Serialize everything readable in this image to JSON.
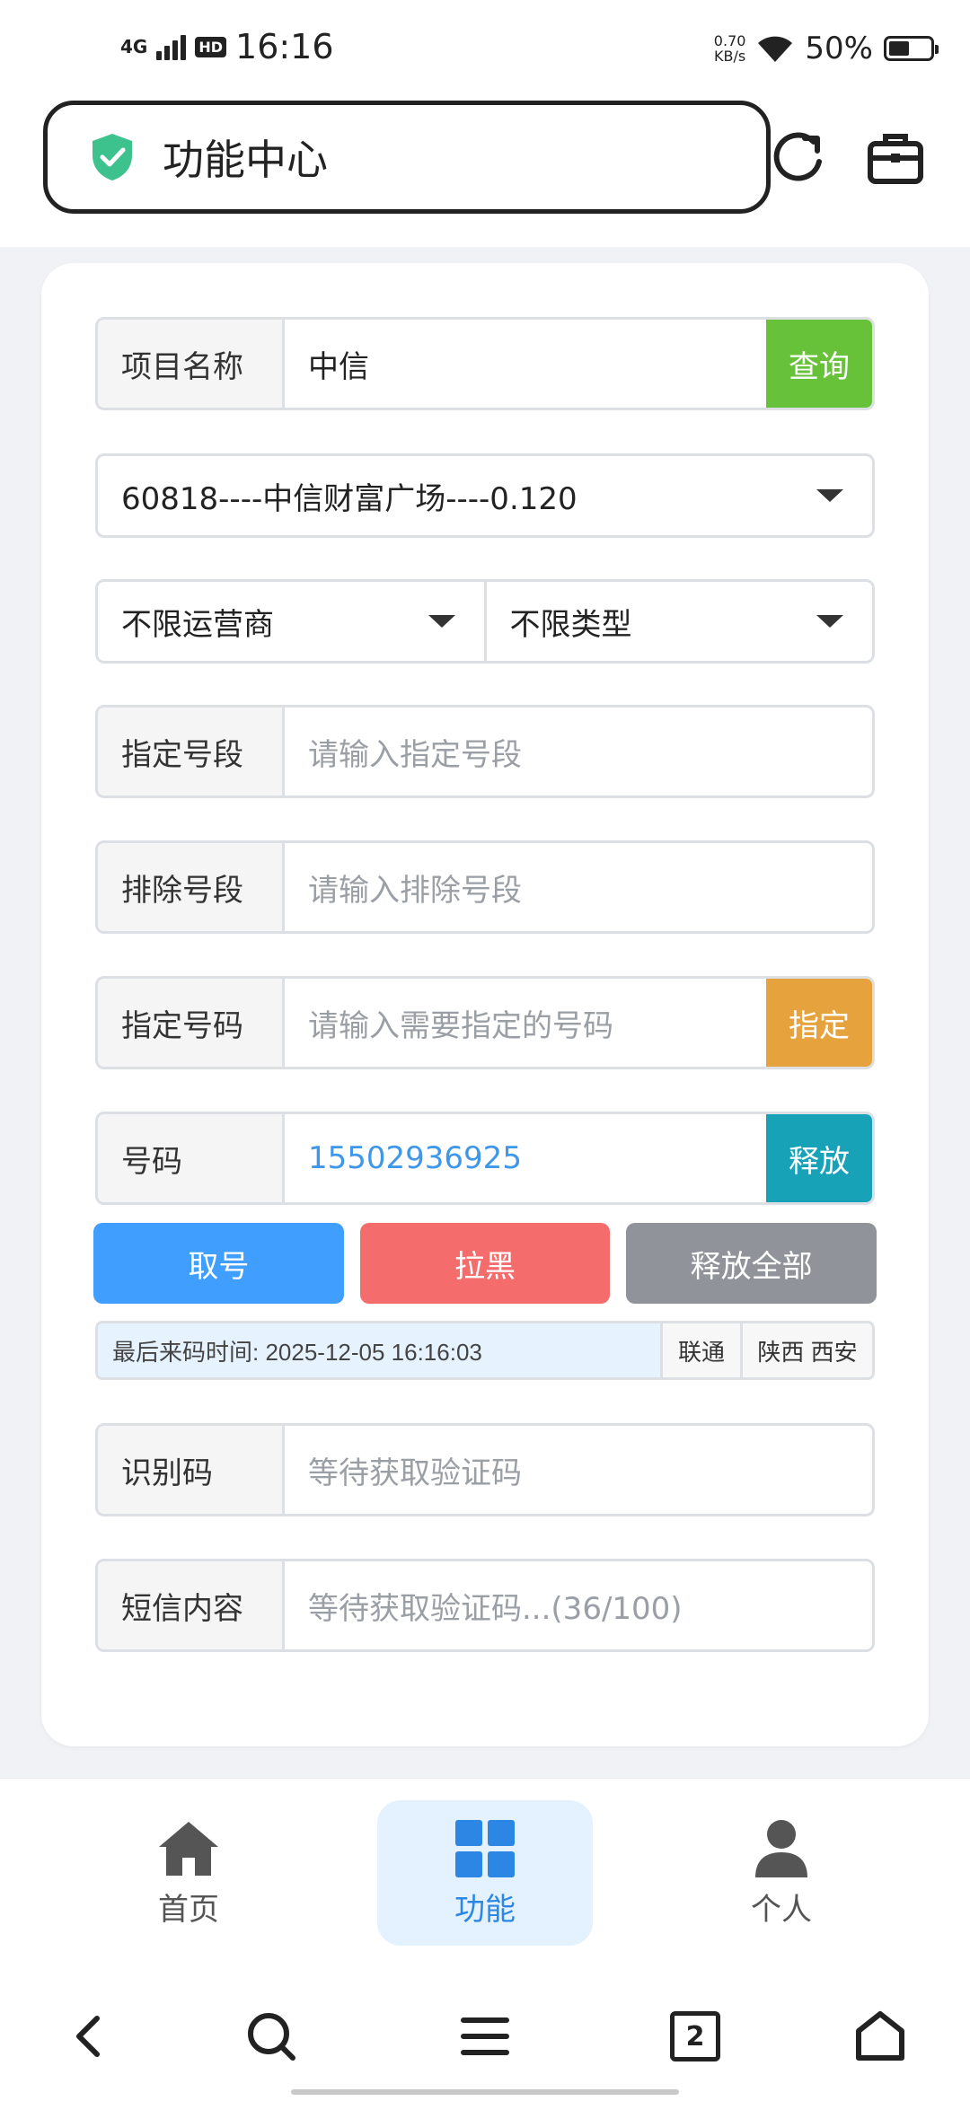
{
  "status_bar": {
    "network": "4G",
    "hd": "HD",
    "time": "16:16",
    "speed_value": "0.70",
    "speed_unit": "KB/s",
    "battery_percent": "50%",
    "battery_level": 0.5
  },
  "header": {
    "title": "功能中心",
    "icons": [
      "shield-check-icon",
      "refresh-icon",
      "briefcase-icon"
    ]
  },
  "form": {
    "project": {
      "label": "项目名称",
      "value": "中信",
      "button": "查询"
    },
    "project_select": "60818----中信财富广场----0.120",
    "operator_select": "不限运营商",
    "type_select": "不限类型",
    "number_prefix": {
      "label": "指定号段",
      "placeholder": "请输入指定号段"
    },
    "exclude_prefix": {
      "label": "排除号段",
      "placeholder": "请输入排除号段"
    },
    "specified_number": {
      "label": "指定号码",
      "placeholder": "请输入需要指定的号码",
      "button": "指定"
    },
    "phone": {
      "label": "号码",
      "value": "15502936925",
      "button": "释放"
    },
    "actions": {
      "get_number": "取号",
      "blacklist": "拉黑",
      "release_all": "释放全部"
    },
    "info": {
      "last_code_time": "最后来码时间: 2025-12-05 16:16:03",
      "carrier": "联通",
      "region": "陕西 西安"
    },
    "verify_code": {
      "label": "识别码",
      "placeholder": "等待获取验证码"
    },
    "sms": {
      "label": "短信内容",
      "placeholder": "等待获取验证码...(36/100)"
    }
  },
  "colors": {
    "query": "#67c23a",
    "specify": "#e6a23c",
    "release": "#17a2b8",
    "get_number": "#409eff",
    "blacklist": "#f56c6c",
    "release_all": "#909399",
    "accent": "#2b87e3"
  },
  "bottom_nav": {
    "items": [
      {
        "label": "首页",
        "icon": "home-icon"
      },
      {
        "label": "功能",
        "icon": "grid-icon",
        "active": true
      },
      {
        "label": "个人",
        "icon": "user-icon"
      }
    ]
  },
  "system_nav": {
    "tab_count": "2"
  }
}
